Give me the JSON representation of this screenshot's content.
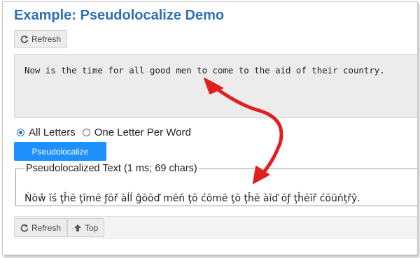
{
  "title": "Example: Pseudolocalize Demo",
  "top_refresh": {
    "label": "Refresh",
    "icon": "refresh-icon"
  },
  "source_text": "Now is the time for all good men to come to the aid of their country.",
  "radio_options": [
    {
      "label": "All Letters",
      "checked": true
    },
    {
      "label": "One Letter Per Word",
      "checked": false
    }
  ],
  "action_button": {
    "label": "Pseudolocalize"
  },
  "result": {
    "legend": "Pseudolocalized Text (1 ms; 69 chars)",
    "text": "Ńōŵ ĭś ţĥē ţĭmē ƒōř àĺĺ ĝōōď mēń ţō ćōmē ţō ţĥē àĭď ōƒ ţĥēĭř ćōũńţřŷ."
  },
  "bottom_buttons": [
    {
      "label": "Refresh",
      "icon": "refresh-icon"
    },
    {
      "label": "Top",
      "icon": "arrow-up-icon"
    }
  ],
  "colors": {
    "title": "#2f6fb3",
    "primary_button": "#1e90ff",
    "annotation_arrow": "#e02020"
  }
}
